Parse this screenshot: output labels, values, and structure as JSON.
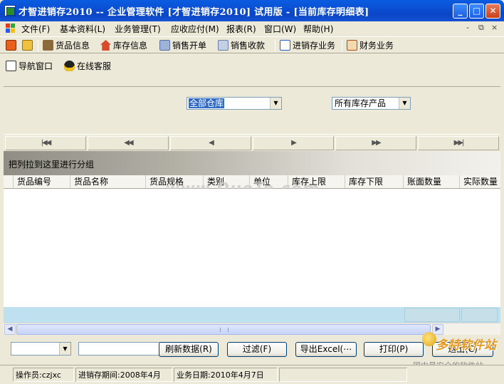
{
  "window": {
    "title": "才智进销存2010 -- 企业管理软件 [才智进销存2010]  试用版 - [当前库存明细表]",
    "minimize": "_",
    "maximize": "□",
    "close": "✕"
  },
  "menu": {
    "items": [
      {
        "label": "文件(F)"
      },
      {
        "label": "基本资料(L)"
      },
      {
        "label": "业务管理(T)"
      },
      {
        "label": "应收应付(M)"
      },
      {
        "label": "报表(R)"
      },
      {
        "label": "窗口(W)"
      },
      {
        "label": "帮助(H)"
      }
    ],
    "mdi_min": "-",
    "mdi_restore": "⧉",
    "mdi_close": "×"
  },
  "toolbar": {
    "items": [
      {
        "label": "货品信息",
        "icon": "goods-icon"
      },
      {
        "label": "库存信息",
        "icon": "house-icon"
      },
      {
        "label": "销售开单",
        "icon": "sales-order-icon"
      },
      {
        "label": "销售收款",
        "icon": "receipt-icon"
      },
      {
        "label": "进销存业务",
        "icon": "document-icon"
      },
      {
        "label": "财务业务",
        "icon": "ledger-icon"
      }
    ],
    "nav_window": "导航窗口",
    "online_service": "在线客服"
  },
  "filters": {
    "warehouse": "全部仓库",
    "product_scope": "所有库存产品"
  },
  "navigation": {
    "first": "|◀◀",
    "prev_page": "◀◀",
    "prev": "◀",
    "next": "▶",
    "next_page": "▶▶",
    "last": "▶▶|"
  },
  "grid": {
    "group_hint": "把列拉到这里进行分组",
    "columns": [
      "货品编号",
      "货品名称",
      "货品规格",
      "类别",
      "单位",
      "库存上限",
      "库存下限",
      "账面数量",
      "实际数量"
    ],
    "watermark": "www.DuoTe.com"
  },
  "actions": {
    "search_value": "",
    "refresh": "刷新数据(R)",
    "filter": "过滤(F)",
    "export": "导出Excel(⋯",
    "print": "打印(P)",
    "exit": "退出(C)"
  },
  "brand": {
    "name": "多特软件站",
    "slogan": "国内最安全的软件站"
  },
  "status": {
    "operator": "操作员:czjxc",
    "period": "进销存期间:2008年4月",
    "business_date": "业务日期:2010年4月7日"
  },
  "colors": {
    "title_bar": "#0b4fd4",
    "selection": "#316ac5",
    "grid_footer": "#bfe0ee"
  }
}
